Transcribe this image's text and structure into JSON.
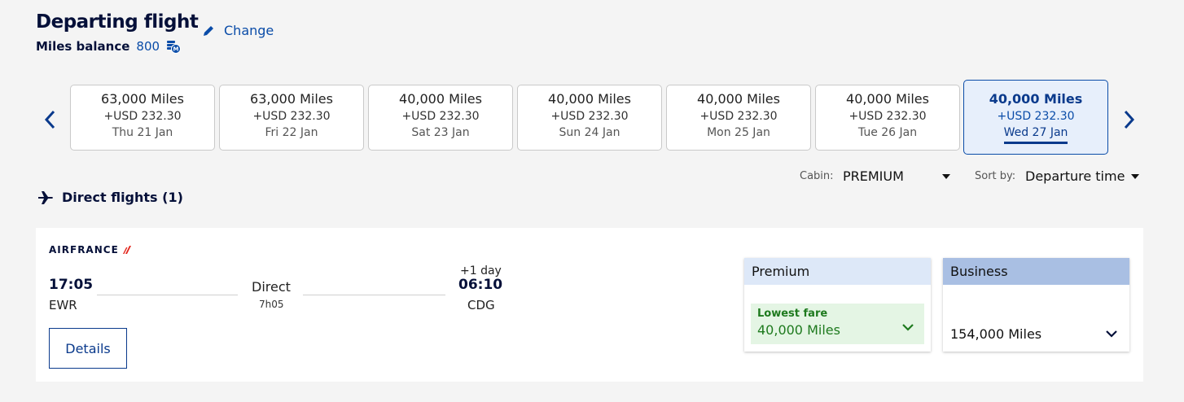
{
  "header": {
    "title": "Departing flight",
    "miles_label": "Miles balance",
    "miles_value": "800",
    "change_label": "Change"
  },
  "dates": [
    {
      "miles": "63,000 Miles",
      "usd": "+USD 232.30",
      "date": "Thu 21 Jan"
    },
    {
      "miles": "63,000 Miles",
      "usd": "+USD 232.30",
      "date": "Fri 22 Jan"
    },
    {
      "miles": "40,000 Miles",
      "usd": "+USD 232.30",
      "date": "Sat 23 Jan"
    },
    {
      "miles": "40,000 Miles",
      "usd": "+USD 232.30",
      "date": "Sun 24 Jan"
    },
    {
      "miles": "40,000 Miles",
      "usd": "+USD 232.30",
      "date": "Mon 25 Jan"
    },
    {
      "miles": "40,000 Miles",
      "usd": "+USD 232.30",
      "date": "Tue 26 Jan"
    },
    {
      "miles": "40,000 Miles",
      "usd": "+USD 232.30",
      "date": "Wed 27 Jan",
      "selected": true
    }
  ],
  "filters": {
    "cabin_label": "Cabin:",
    "cabin_value": "PREMIUM",
    "sort_label": "Sort by:",
    "sort_value": "Departure time"
  },
  "section": {
    "direct_label": "Direct flights (1)"
  },
  "flight": {
    "airline": "AIRFRANCE",
    "depart_time": "17:05",
    "depart_airport": "EWR",
    "stop_type": "Direct",
    "duration": "7h05",
    "day_offset": "+1 day",
    "arrive_time": "06:10",
    "arrive_airport": "CDG",
    "details_label": "Details"
  },
  "fares": {
    "premium": {
      "name": "Premium",
      "badge": "Lowest fare",
      "miles": "40,000 Miles"
    },
    "business": {
      "name": "Business",
      "miles": "154,000 Miles"
    }
  },
  "colors": {
    "brand_blue": "#0a4ca8",
    "navy": "#051039",
    "green": "#1e7a1e",
    "logo_red": "#e2231a"
  }
}
